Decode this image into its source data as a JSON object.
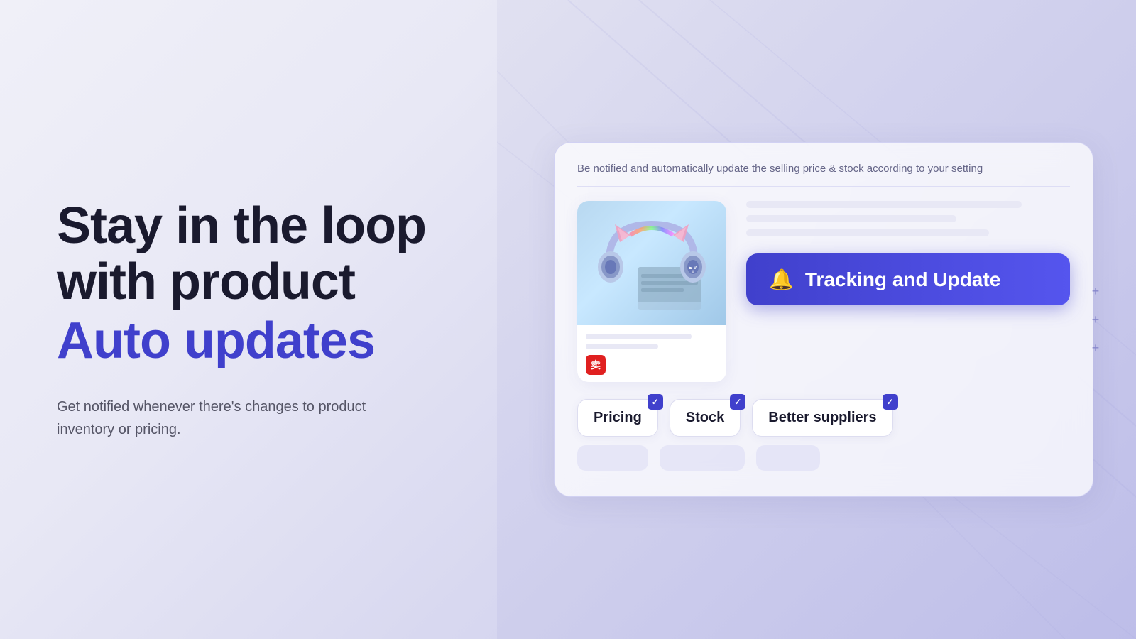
{
  "background": {
    "color_left": "#f0f0f8",
    "color_right": "#c8c8ea"
  },
  "left": {
    "headline_line1": "Stay in the loop",
    "headline_line2": "with product",
    "headline_accent": "Auto updates",
    "description": "Get notified whenever there's changes to product inventory or pricing."
  },
  "right": {
    "card_subtitle": "Be notified and automatically update the selling price & stock according to your setting",
    "tracking_button_label": "Tracking and Update",
    "bell_icon": "🔔",
    "tags": [
      {
        "label": "Pricing"
      },
      {
        "label": "Stock"
      },
      {
        "label": "Better suppliers"
      }
    ],
    "product_logo": "卖",
    "plus_symbol": "+"
  }
}
